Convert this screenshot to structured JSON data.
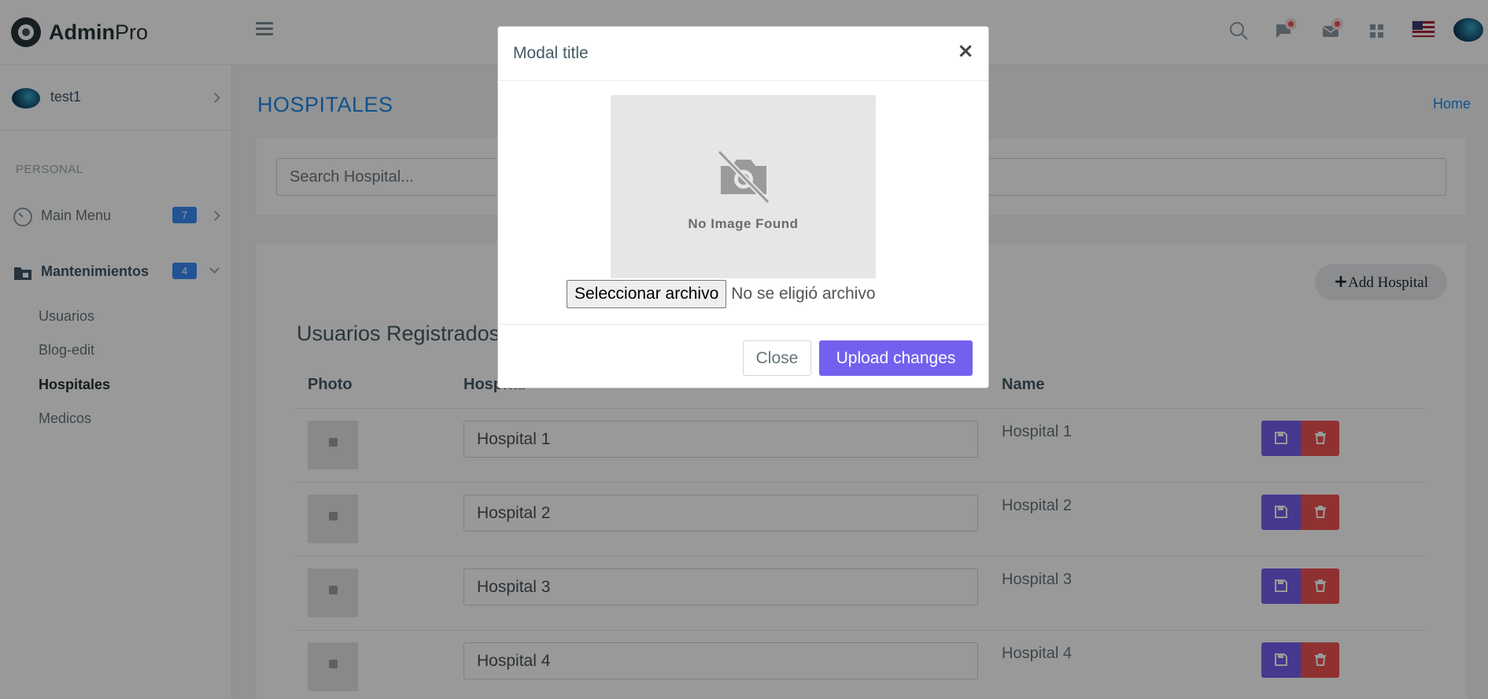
{
  "brand": {
    "prefix": "Admin",
    "suffix": "Pro"
  },
  "sidebar": {
    "user": {
      "name": "test1"
    },
    "section_label": "PERSONAL",
    "items": [
      {
        "label": "Main Menu",
        "badge": "7",
        "icon": "gauge-icon"
      },
      {
        "label": "Mantenimientos",
        "badge": "4",
        "icon": "folder-lock-icon"
      }
    ],
    "subitems": [
      "Usuarios",
      "Blog-edit",
      "Hospitales",
      "Medicos"
    ],
    "active_subitem": "Hospitales"
  },
  "page": {
    "title": "HOSPITALES",
    "breadcrumb": "Home"
  },
  "search": {
    "placeholder": "Search Hospital..."
  },
  "list": {
    "add_button": "Add Hospital",
    "title": "Usuarios Registrados",
    "columns": [
      "Photo",
      "Hospital",
      "Name"
    ],
    "rows": [
      {
        "hospital": "Hospital 1",
        "name": "Hospital 1"
      },
      {
        "hospital": "Hospital 2",
        "name": "Hospital 2"
      },
      {
        "hospital": "Hospital 3",
        "name": "Hospital 3"
      },
      {
        "hospital": "Hospital 4",
        "name": "Hospital 4"
      }
    ]
  },
  "modal": {
    "title": "Modal title",
    "close_symbol": "×",
    "image_text": "No Image Found",
    "file_button": "Seleccionar archivo",
    "file_status": "No se eligió archivo",
    "close_button": "Close",
    "upload_button": "Upload changes"
  },
  "colors": {
    "primary": "#7460ee",
    "danger": "#ef5350",
    "info": "#1e88e5",
    "badge": "#398bf7"
  }
}
